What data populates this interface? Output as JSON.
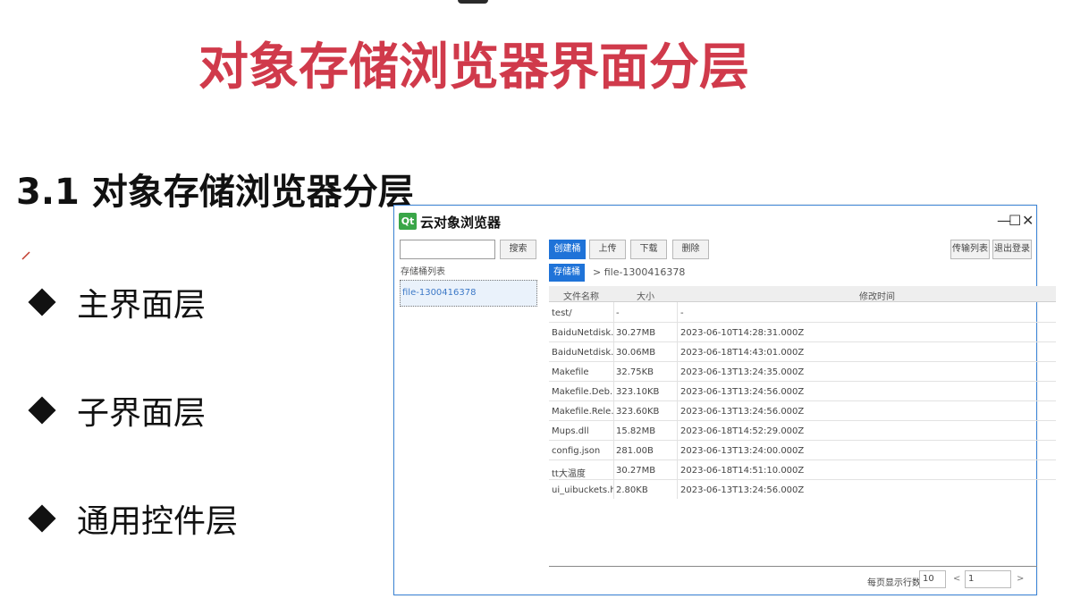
{
  "slide": {
    "title": "对象存储浏览器界面分层",
    "section": "3.1 对象存储浏览器分层",
    "bullets": [
      "主界面层",
      "子界面层",
      "通用控件层"
    ]
  },
  "window": {
    "logo": "Qt",
    "title": "云对象浏览器",
    "controls": {
      "minimize": "—",
      "maximize": "☐",
      "close": "✕"
    },
    "search_button": "搜索",
    "toolbar": [
      "创建桶",
      "上传",
      "下载",
      "删除"
    ],
    "right_buttons": [
      "传输列表",
      "退出登录"
    ],
    "bucket_list_label": "存储桶列表",
    "buckets": [
      "file-1300416378"
    ],
    "breadcrumb": {
      "root": "存储桶",
      "path": "> file-1300416378"
    },
    "table": {
      "headers": [
        "文件名称",
        "大小",
        "修改时间"
      ],
      "rows": [
        [
          "test/",
          "-",
          "-"
        ],
        [
          "BaiduNetdisk...",
          "30.27MB",
          "2023-06-10T14:28:31.000Z"
        ],
        [
          "BaiduNetdisk...",
          "30.06MB",
          "2023-06-18T14:43:01.000Z"
        ],
        [
          "Makefile",
          "32.75KB",
          "2023-06-13T13:24:35.000Z"
        ],
        [
          "Makefile.Deb...",
          "323.10KB",
          "2023-06-13T13:24:56.000Z"
        ],
        [
          "Makefile.Rele...",
          "323.60KB",
          "2023-06-13T13:24:56.000Z"
        ],
        [
          "Mups.dll",
          "15.82MB",
          "2023-06-18T14:52:29.000Z"
        ],
        [
          "config.json",
          "281.00B",
          "2023-06-13T13:24:00.000Z"
        ],
        [
          "tt大温度",
          "30.27MB",
          "2023-06-18T14:51:10.000Z"
        ],
        [
          "ui_uibuckets.h",
          "2.80KB",
          "2023-06-13T13:24:56.000Z"
        ]
      ]
    },
    "pagination": {
      "label": "每页显示行数",
      "rows_per_page": "10",
      "prev": "<",
      "page": "1",
      "next": ">"
    }
  }
}
